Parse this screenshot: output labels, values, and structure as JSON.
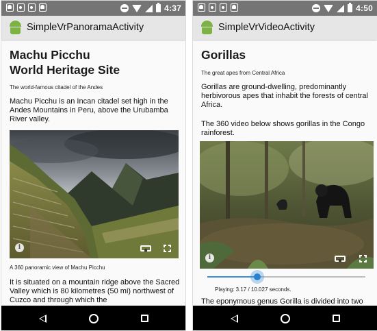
{
  "left_screen": {
    "status_bar": {
      "time": "4:37",
      "left_icons": [
        "android-icon",
        "photo-icon",
        "photo-icon",
        "android-icon"
      ],
      "right_icons": [
        "do-not-disturb-icon",
        "wifi-icon",
        "signal-icon",
        "battery-icon"
      ]
    },
    "app_bar": {
      "title": "SimpleVrPanoramaActivity",
      "icon": "android-logo-icon"
    },
    "content": {
      "heading_line1": "Machu Picchu",
      "heading_line2": "World Heritage Site",
      "subtitle": "The world-famous citadel of the Andes",
      "paragraph1": "Machu Picchu is an Incan citadel set high in the Andes Mountains in Peru, above the Urubamba River valley.",
      "media_controls": [
        "info-icon",
        "cardboard-icon",
        "fullscreen-icon"
      ],
      "caption": "A 360 panoramic view of Machu Picchu",
      "paragraph2": "It is situated on a mountain ridge above the Sacred Valley which is 80 kilometres (50 mi) northwest of Cuzco and through which the"
    },
    "nav_bar": [
      "back-icon",
      "home-icon",
      "recents-icon"
    ]
  },
  "right_screen": {
    "status_bar": {
      "time": "4:50",
      "left_icons": [
        "android-icon",
        "photo-icon",
        "photo-icon",
        "android-icon"
      ],
      "right_icons": [
        "do-not-disturb-icon",
        "wifi-icon",
        "signal-icon",
        "battery-icon"
      ]
    },
    "app_bar": {
      "title": "SimpleVrVideoActivity",
      "icon": "android-logo-icon"
    },
    "content": {
      "heading": "Gorillas",
      "subtitle": "The great apes from Central Africa",
      "paragraph1": "Gorillas are ground-dwelling, predominantly herbivorous apes that inhabit the forests of central Africa.",
      "paragraph2": "The 360 video below shows gorillas in the Congo rainforest.",
      "media_controls": [
        "info-icon",
        "cardboard-icon",
        "fullscreen-icon"
      ],
      "seek_progress": 0.316,
      "status_text": "Playing: 3.17 / 10.027 seconds.",
      "paragraph3": "The eponymous genus Gorilla is divided into two"
    },
    "nav_bar": [
      "back-icon",
      "home-icon",
      "recents-icon"
    ]
  },
  "colors": {
    "status_bar": "#757575",
    "app_bar": "#e6e6e6",
    "android_green": "#7cb342",
    "seek_accent": "#2b7fd0",
    "nav_bar": "#000000"
  }
}
